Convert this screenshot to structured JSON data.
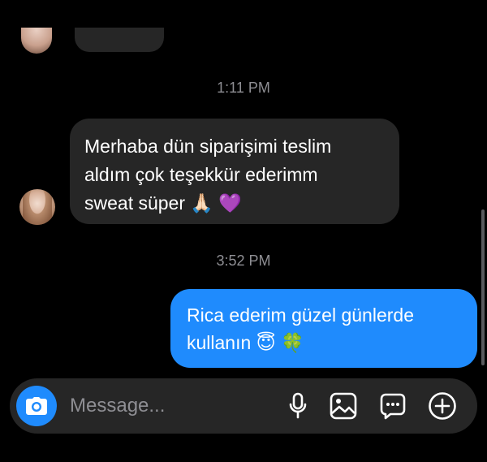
{
  "conversation": {
    "timestamps": [
      "1:11 PM",
      "3:52 PM"
    ],
    "incoming": {
      "lines": [
        "Merhaba dün siparişimi teslim",
        "aldım çok teşekkür ederimm",
        "sweat süper 🙏🏻 💜"
      ]
    },
    "outgoing": {
      "lines": [
        "Rica ederim güzel günlerde",
        "kullanın 😇 🍀"
      ]
    }
  },
  "composer": {
    "placeholder": "Message..."
  },
  "colors": {
    "background": "#000000",
    "incoming_bubble": "#262626",
    "outgoing_bubble": "#1f8bfd",
    "timestamp": "#8e8e93"
  },
  "icons": [
    "camera-icon",
    "microphone-icon",
    "gallery-icon",
    "sticker-icon",
    "plus-icon"
  ]
}
